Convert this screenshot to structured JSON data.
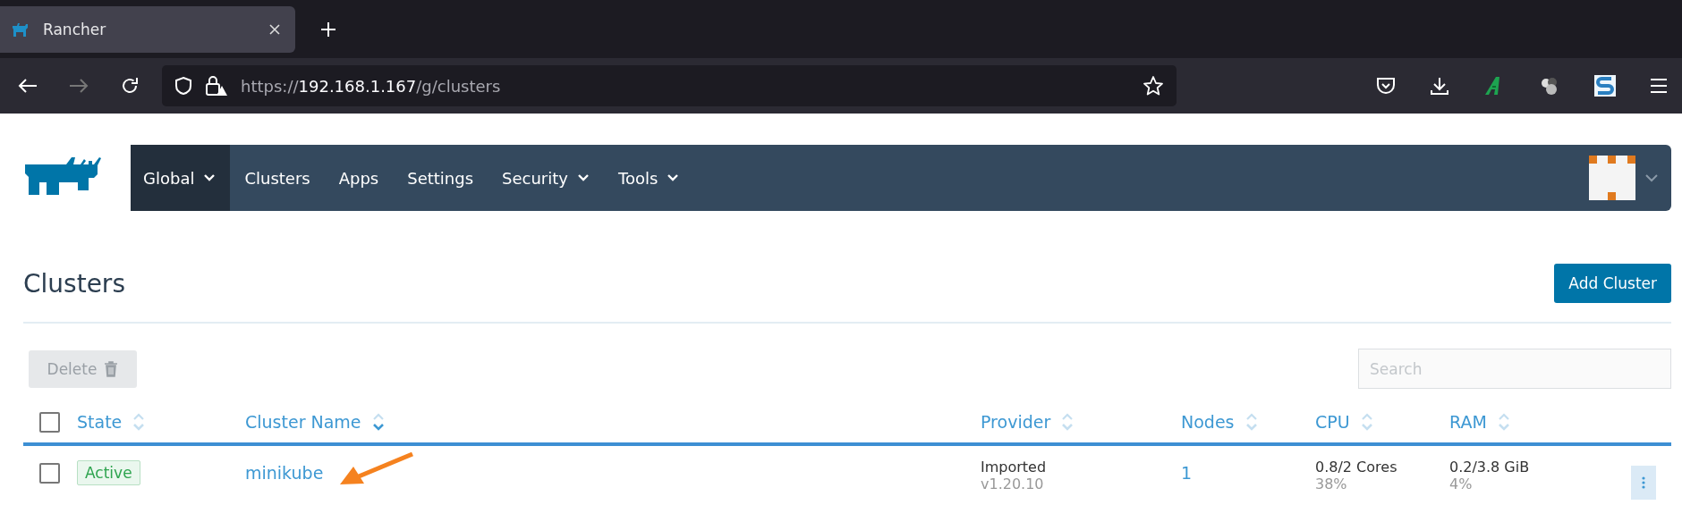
{
  "browser": {
    "tab": {
      "title": "Rancher",
      "selected": true
    },
    "address": {
      "scheme": "https://",
      "host": "192.168.1.167",
      "path": "/g/clusters"
    }
  },
  "nav": {
    "items": [
      {
        "label": "Global",
        "dropdown": true,
        "selected": true
      },
      {
        "label": "Clusters",
        "dropdown": false,
        "selected": false
      },
      {
        "label": "Apps",
        "dropdown": false,
        "selected": false
      },
      {
        "label": "Settings",
        "dropdown": false,
        "selected": false
      },
      {
        "label": "Security",
        "dropdown": true,
        "selected": false
      },
      {
        "label": "Tools",
        "dropdown": true,
        "selected": false
      }
    ]
  },
  "page": {
    "title": "Clusters",
    "add_button": "Add Cluster",
    "delete_button": {
      "label": "Delete",
      "disabled": true
    },
    "search": {
      "placeholder": "Search"
    }
  },
  "table": {
    "select_all": {
      "checked": false
    },
    "columns": [
      {
        "label": "State",
        "sorted": false
      },
      {
        "label": "Cluster Name",
        "sorted": true
      },
      {
        "label": "Provider",
        "sorted": false
      },
      {
        "label": "Nodes",
        "sorted": false
      },
      {
        "label": "CPU",
        "sorted": false
      },
      {
        "label": "RAM",
        "sorted": false
      }
    ],
    "rows": [
      {
        "checked": false,
        "state": "Active",
        "name": "minikube",
        "provider": "Imported",
        "version": "v1.20.10",
        "nodes": "1",
        "cpu": "0.8/2 Cores",
        "cpu_pct": "38%",
        "ram": "0.2/3.8 GiB",
        "ram_pct": "4%"
      }
    ]
  },
  "annotations": [
    {
      "kind": "arrow",
      "color": "#f5821f"
    }
  ]
}
